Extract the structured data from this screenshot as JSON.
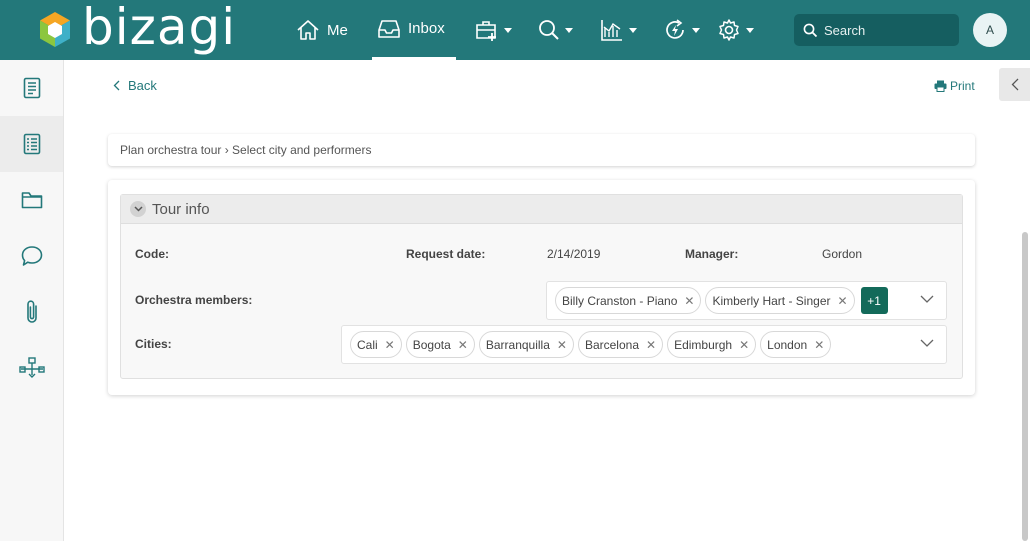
{
  "header": {
    "brand": "bizagi",
    "nav": {
      "me_label": "Me",
      "inbox_label": "Inbox"
    },
    "search": {
      "placeholder": "Search"
    },
    "avatar_initial": "A"
  },
  "toolbar": {
    "back_label": "Back",
    "print_label": "Print"
  },
  "breadcrumb": {
    "text": "Plan orchestra tour › Select city and performers"
  },
  "form": {
    "group_title": "Tour info",
    "fields": {
      "code_label": "Code:",
      "request_date_label": "Request date:",
      "request_date_value": "2/14/2019",
      "manager_label": "Manager:",
      "manager_value": "Gordon",
      "members_label": "Orchestra members:",
      "members": [
        "Billy Cranston - Piano",
        "Kimberly Hart - Singer"
      ],
      "members_more": "+1",
      "cities_label": "Cities:",
      "cities": [
        "Cali",
        "Bogota",
        "Barranquilla",
        "Barcelona",
        "Edimburgh",
        "London"
      ]
    }
  },
  "colors": {
    "header_bg": "#23787a",
    "accent": "#23787a",
    "badge": "#136a5a"
  }
}
